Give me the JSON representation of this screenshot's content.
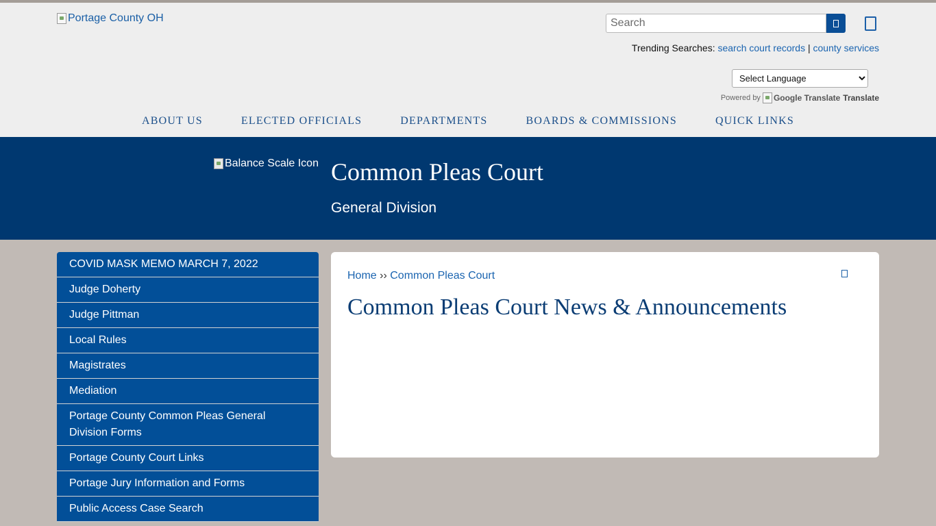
{
  "header": {
    "logo_alt": "Portage County OH",
    "search": {
      "placeholder": "Search",
      "button_glyph": ""
    },
    "trending": {
      "label": "Trending Searches:",
      "links": [
        "search court records",
        "county services"
      ],
      "separator": "|"
    },
    "language": {
      "selected": "Select Language"
    },
    "powered_by": {
      "label": "Powered by",
      "google_alt": "Google Translate",
      "translate": "Translate"
    }
  },
  "nav": {
    "items": [
      "ABOUT US",
      "ELECTED OFFICIALS",
      "DEPARTMENTS",
      "BOARDS & COMMISSIONS",
      "QUICK LINKS"
    ]
  },
  "hero": {
    "icon_alt": "Balance Scale Icon",
    "title": "Common Pleas Court",
    "subtitle": "General Division"
  },
  "sidebar": {
    "items": [
      "COVID MASK MEMO MARCH 7, 2022",
      "Judge Doherty",
      "Judge Pittman",
      "Local Rules",
      "Magistrates",
      "Mediation",
      "Portage County Common Pleas General Division Forms",
      "Portage County Court Links",
      "Portage Jury Information and Forms",
      "Public Access Case Search"
    ]
  },
  "content": {
    "breadcrumb": {
      "home": "Home",
      "sep": "››",
      "current": "Common Pleas Court"
    },
    "title": "Common Pleas Court News & Announcements"
  },
  "colors": {
    "brand_blue": "#003870",
    "nav_blue": "#024f98",
    "link_blue": "#1a64b0",
    "page_bg": "#c1bab5",
    "header_bg": "#eeeeee"
  },
  "icons": {
    "search": "search-icon",
    "share": "bookmark-icon",
    "print": "print-icon"
  }
}
